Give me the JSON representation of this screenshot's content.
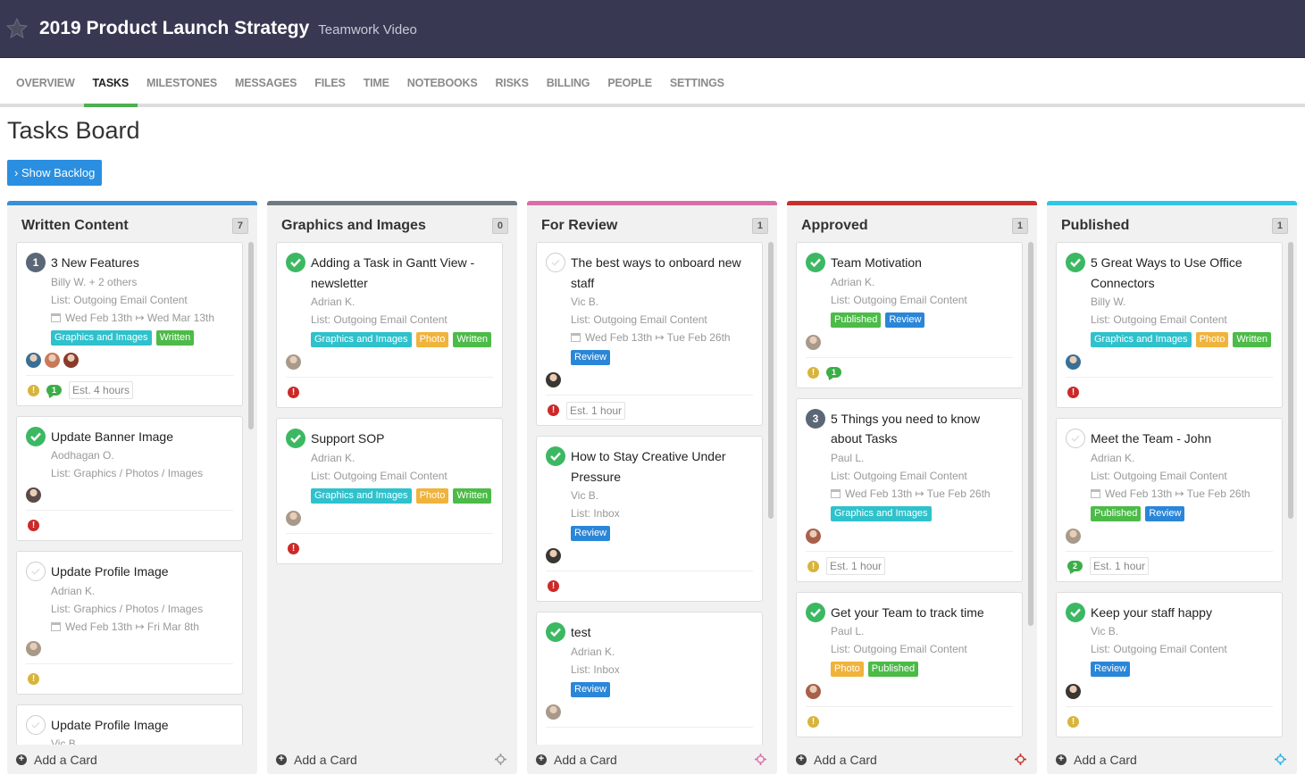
{
  "header": {
    "title": "2019 Product Launch Strategy",
    "subtitle": "Teamwork Video",
    "star_icon": "star-icon"
  },
  "tabs": [
    {
      "label": "OVERVIEW",
      "active": false
    },
    {
      "label": "TASKS",
      "active": true
    },
    {
      "label": "MILESTONES",
      "active": false
    },
    {
      "label": "MESSAGES",
      "active": false
    },
    {
      "label": "FILES",
      "active": false
    },
    {
      "label": "TIME",
      "active": false
    },
    {
      "label": "NOTEBOOKS",
      "active": false
    },
    {
      "label": "RISKS",
      "active": false
    },
    {
      "label": "BILLING",
      "active": false
    },
    {
      "label": "PEOPLE",
      "active": false
    },
    {
      "label": "SETTINGS",
      "active": false
    }
  ],
  "page": {
    "title": "Tasks Board",
    "backlog_button": "› Show Backlog",
    "add_card_label": "Add a Card"
  },
  "colors": {
    "header_bg": "#383853",
    "accent_tab": "#4caf50",
    "button": "#2a8fe0",
    "tag_graphics": "#2fc1cc",
    "tag_written": "#4cbb48",
    "tag_photo": "#f0b33c",
    "tag_review": "#2a86d8",
    "tag_published": "#4cbb48",
    "warn_yellow": "#d8b43c",
    "warn_red": "#cc2929"
  },
  "columns": [
    {
      "title": "Written Content",
      "count": "7",
      "color": "#3a8fd6",
      "move_color": "",
      "cards": [
        {
          "status": "num",
          "num": "1",
          "title": "3 New Features",
          "assignee": "Billy W. + 2 others",
          "list": "List: Outgoing Email Content",
          "dates": "Wed Feb 13th ↦ Wed Mar 13th",
          "tags": [
            "Graphics and Images",
            "Written"
          ],
          "avatars": [
            "#3a6f95",
            "#c9785a",
            "#8a3a2a"
          ],
          "priority": "yellow",
          "comments": "1",
          "estimate": "Est. 4 hours"
        },
        {
          "status": "done",
          "title": "Update Banner Image",
          "assignee": "Aodhagan O.",
          "list": "List: Graphics / Photos / Images",
          "dates": "",
          "tags": [],
          "avatars": [
            "#5a4a48"
          ],
          "priority": "red",
          "comments": "",
          "estimate": ""
        },
        {
          "status": "open",
          "title": "Update Profile Image",
          "assignee": "Adrian K.",
          "list": "List: Graphics / Photos / Images",
          "dates": "Wed Feb 13th ↦ Fri Mar 8th",
          "tags": [],
          "avatars": [
            "#a89a8a"
          ],
          "priority": "yellow",
          "comments": "",
          "estimate": ""
        },
        {
          "status": "open",
          "title": "Update Profile Image",
          "assignee": "Vic B.",
          "list": "",
          "dates": "",
          "tags": [],
          "avatars": [],
          "priority": "",
          "comments": "",
          "estimate": ""
        }
      ]
    },
    {
      "title": "Graphics and Images",
      "count": "0",
      "color": "#6f7a80",
      "move_color": "#999999",
      "cards": [
        {
          "status": "done",
          "title": "Adding a Task in Gantt View - newsletter",
          "assignee": "Adrian K.",
          "list": "List: Outgoing Email Content",
          "dates": "",
          "tags": [
            "Graphics and Images",
            "Photo",
            "Written"
          ],
          "avatars": [
            "#a89a8a"
          ],
          "priority": "red",
          "comments": "",
          "estimate": ""
        },
        {
          "status": "done",
          "title": "Support SOP",
          "assignee": "Adrian K.",
          "list": "List: Outgoing Email Content",
          "dates": "",
          "tags": [
            "Graphics and Images",
            "Photo",
            "Written"
          ],
          "avatars": [
            "#a89a8a"
          ],
          "priority": "red",
          "comments": "",
          "estimate": ""
        }
      ]
    },
    {
      "title": "For Review",
      "count": "1",
      "color": "#d96fa8",
      "move_color": "#d96fa8",
      "cards": [
        {
          "status": "open",
          "title": "The best ways to onboard new staff",
          "assignee": "Vic B.",
          "list": "List: Outgoing Email Content",
          "dates": "Wed Feb 13th ↦ Tue Feb 26th",
          "tags": [
            "Review"
          ],
          "avatars": [
            "#3a3632"
          ],
          "priority": "red",
          "comments": "",
          "estimate": "Est. 1 hour"
        },
        {
          "status": "done",
          "title": "How to Stay Creative Under Pressure",
          "assignee": "Vic B.",
          "list": "List: Inbox",
          "dates": "",
          "tags": [
            "Review"
          ],
          "avatars": [
            "#3a3632"
          ],
          "priority": "red",
          "comments": "",
          "estimate": ""
        },
        {
          "status": "done",
          "title": "test",
          "assignee": "Adrian K.",
          "list": "List: Inbox",
          "dates": "",
          "tags": [
            "Review"
          ],
          "avatars": [
            "#a89a8a"
          ],
          "priority": "",
          "comments": "",
          "estimate": ""
        }
      ]
    },
    {
      "title": "Approved",
      "count": "1",
      "color": "#c9302c",
      "move_color": "#c9302c",
      "cards": [
        {
          "status": "done",
          "title": "Team Motivation",
          "assignee": "Adrian K.",
          "list": "List: Outgoing Email Content",
          "dates": "",
          "tags": [
            "Published",
            "Review"
          ],
          "avatars": [
            "#a89a8a"
          ],
          "priority": "yellow",
          "comments": "1",
          "estimate": ""
        },
        {
          "status": "num",
          "num": "3",
          "title": "5 Things you need to know about Tasks",
          "assignee": "Paul L.",
          "list": "List: Outgoing Email Content",
          "dates": "Wed Feb 13th ↦ Tue Feb 26th",
          "tags": [
            "Graphics and Images"
          ],
          "avatars": [
            "#a8604a"
          ],
          "priority": "yellow",
          "comments": "",
          "estimate": "Est. 1 hour"
        },
        {
          "status": "done",
          "title": "Get your Team to track time",
          "assignee": "Paul L.",
          "list": "List: Outgoing Email Content",
          "dates": "",
          "tags": [
            "Photo",
            "Published"
          ],
          "avatars": [
            "#a8604a"
          ],
          "priority": "yellow",
          "comments": "",
          "estimate": ""
        }
      ]
    },
    {
      "title": "Published",
      "count": "1",
      "color": "#2fc7e6",
      "move_color": "#2fb0e6",
      "cards": [
        {
          "status": "done",
          "title": "5 Great Ways to Use Office Connectors",
          "assignee": "Billy W.",
          "list": "List: Outgoing Email Content",
          "dates": "",
          "tags": [
            "Graphics and Images",
            "Photo",
            "Written"
          ],
          "avatars": [
            "#3a6f95"
          ],
          "priority": "red",
          "comments": "",
          "estimate": ""
        },
        {
          "status": "open",
          "title": "Meet the Team - John",
          "assignee": "Adrian K.",
          "list": "List: Outgoing Email Content",
          "dates": "Wed Feb 13th ↦ Tue Feb 26th",
          "tags": [
            "Published",
            "Review"
          ],
          "avatars": [
            "#a89a8a"
          ],
          "priority": "",
          "comments": "2",
          "estimate": "Est. 1 hour"
        },
        {
          "status": "done",
          "title": "Keep your staff happy",
          "assignee": "Vic B.",
          "list": "List: Outgoing Email Content",
          "dates": "",
          "tags": [
            "Review"
          ],
          "avatars": [
            "#3a3632"
          ],
          "priority": "yellow",
          "comments": "",
          "estimate": ""
        }
      ]
    }
  ]
}
